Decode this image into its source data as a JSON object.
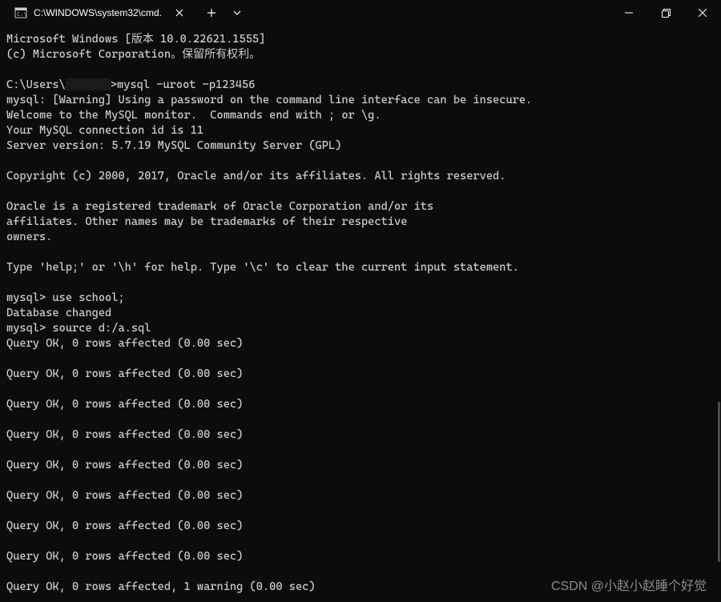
{
  "tab": {
    "title": "C:\\WINDOWS\\system32\\cmd."
  },
  "terminal": {
    "lines": [
      "Microsoft Windows [版本 10.0.22621.1555]",
      "(c) Microsoft Corporation。保留所有权利。",
      "",
      "__PROMPT__mysql -uroot -p123456",
      "mysql: [Warning] Using a password on the command line interface can be insecure.",
      "Welcome to the MySQL monitor.  Commands end with ; or \\g.",
      "Your MySQL connection id is 11",
      "Server version: 5.7.19 MySQL Community Server (GPL)",
      "",
      "Copyright (c) 2000, 2017, Oracle and/or its affiliates. All rights reserved.",
      "",
      "Oracle is a registered trademark of Oracle Corporation and/or its",
      "affiliates. Other names may be trademarks of their respective",
      "owners.",
      "",
      "Type 'help;' or '\\h' for help. Type '\\c' to clear the current input statement.",
      "",
      "mysql> use school;",
      "Database changed",
      "mysql> source d:/a.sql",
      "Query OK, 0 rows affected (0.00 sec)",
      "",
      "Query OK, 0 rows affected (0.00 sec)",
      "",
      "Query OK, 0 rows affected (0.00 sec)",
      "",
      "Query OK, 0 rows affected (0.00 sec)",
      "",
      "Query OK, 0 rows affected (0.00 sec)",
      "",
      "Query OK, 0 rows affected (0.00 sec)",
      "",
      "Query OK, 0 rows affected (0.00 sec)",
      "",
      "Query OK, 0 rows affected (0.00 sec)",
      "",
      "Query OK, 0 rows affected, 1 warning (0.00 sec)"
    ],
    "prompt_prefix": "C:\\Users\\",
    "prompt_suffix": ">"
  },
  "watermark": "CSDN @小赵小赵睡个好觉"
}
